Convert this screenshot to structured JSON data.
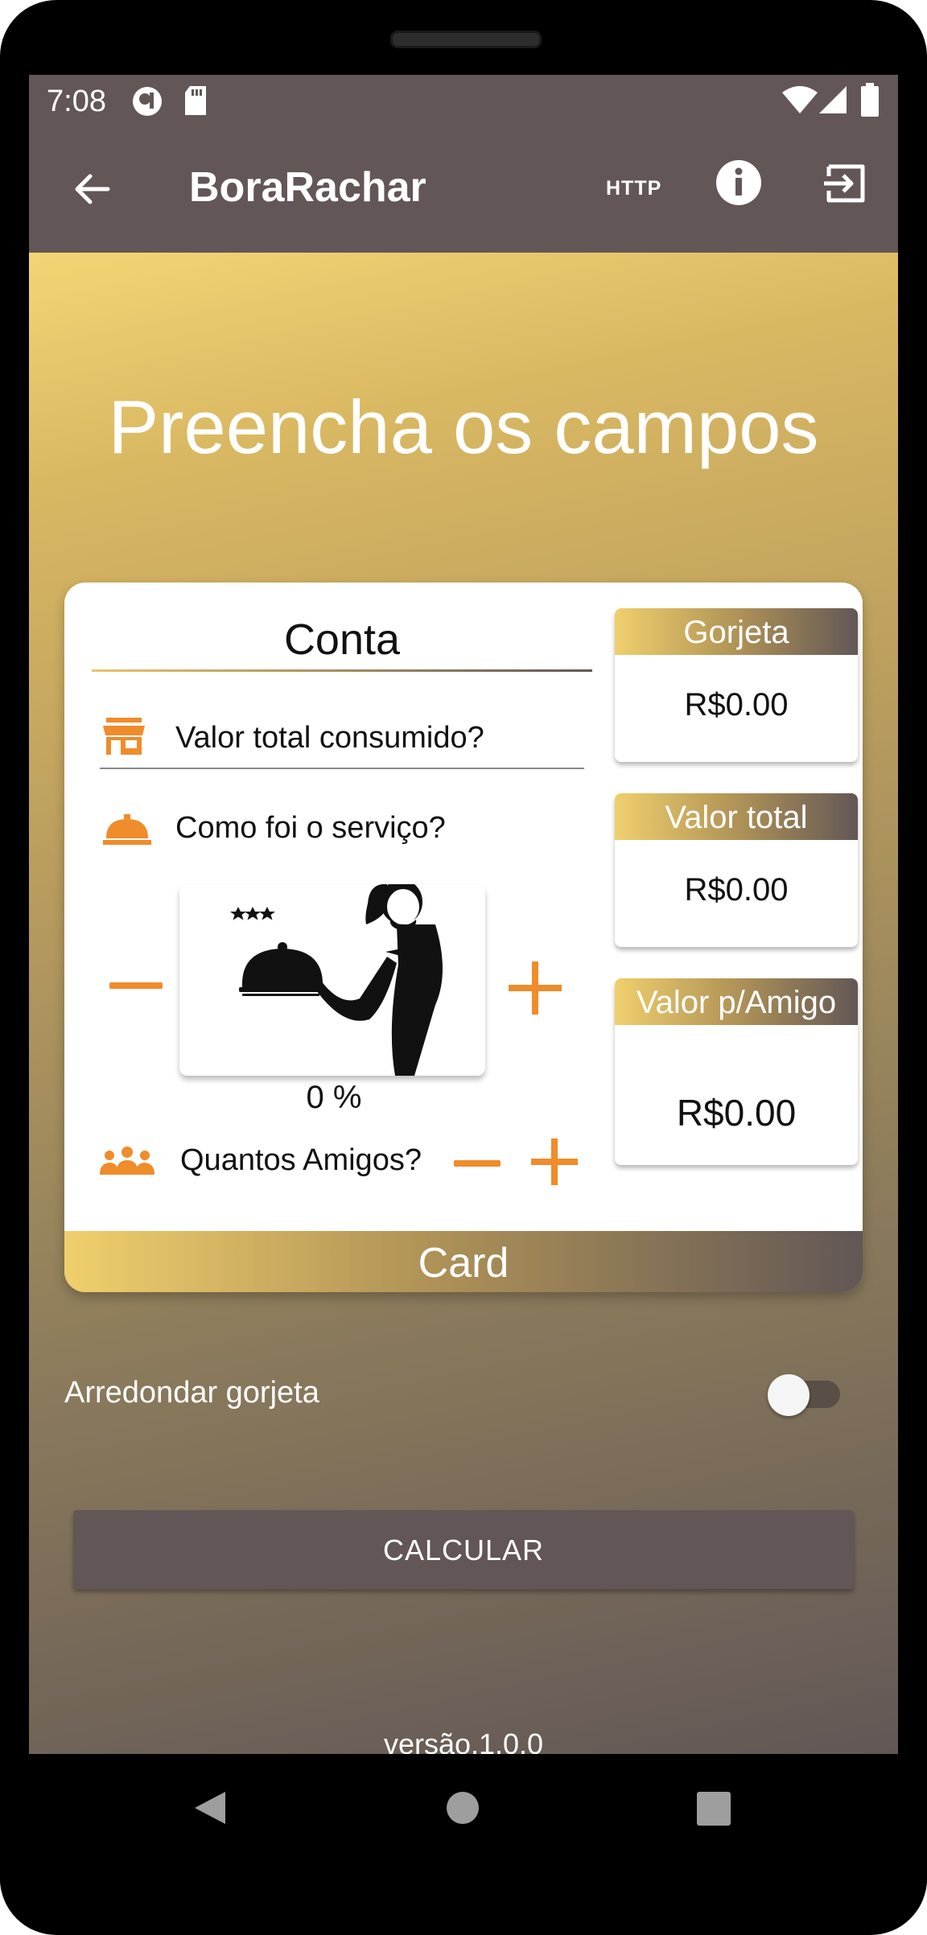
{
  "status": {
    "time": "7:08"
  },
  "appbar": {
    "title": "BoraRachar",
    "http_label": "HTTP"
  },
  "main": {
    "title": "Preencha os campos"
  },
  "card": {
    "section_title": "Conta",
    "total_placeholder": "Valor total consumido?",
    "service_label": "Como foi o serviço?",
    "service_percent": "0 %",
    "friends_label": "Quantos Amigos?",
    "footer": "Card"
  },
  "results": {
    "tip": {
      "label": "Gorjeta",
      "value": "R$0.00"
    },
    "total": {
      "label": "Valor total",
      "value": "R$0.00"
    },
    "per_friend": {
      "label": "Valor p/Amigo",
      "value": "R$0.00"
    }
  },
  "round_tip": {
    "label": "Arredondar gorjeta",
    "enabled": false
  },
  "calculate_button": "CALCULAR",
  "version": "versão.1.0.0",
  "colors": {
    "accent": "#ef8c2b",
    "bar": "#625756",
    "gold": "#f0cf6c"
  }
}
